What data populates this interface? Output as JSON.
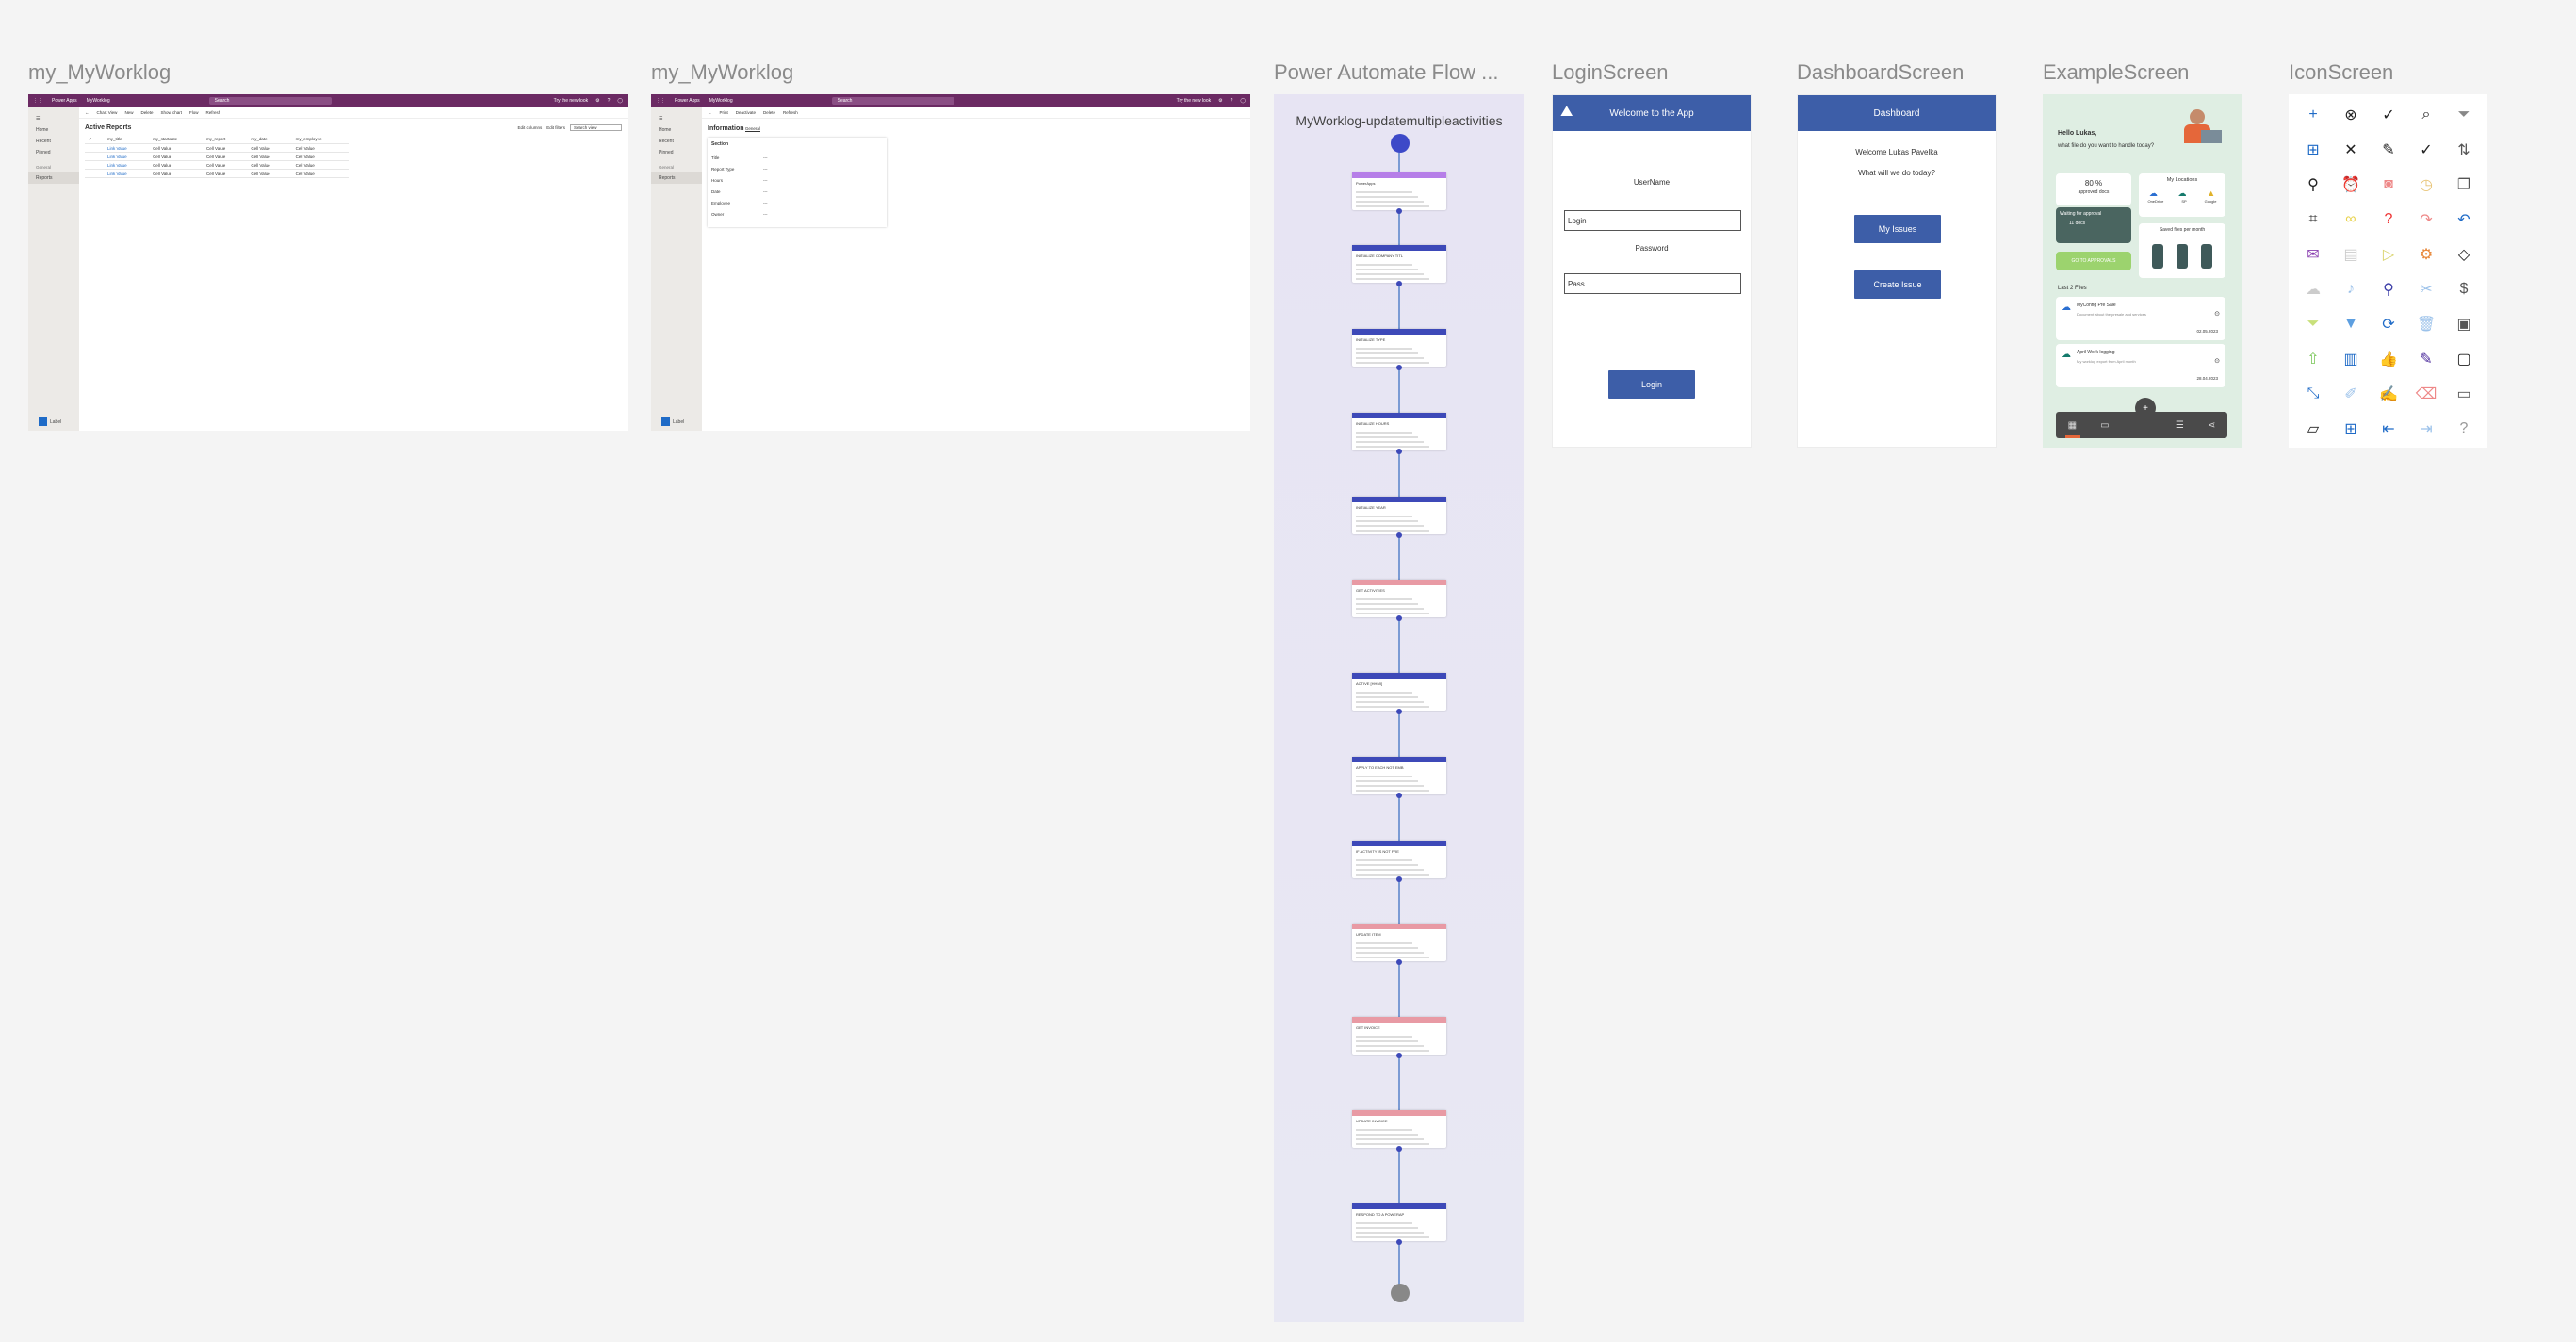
{
  "frames": {
    "f1": {
      "title": "my_MyWorklog"
    },
    "f2": {
      "title": "my_MyWorklog"
    },
    "f3": {
      "title": "Power Automate Flow ..."
    },
    "f4": {
      "title": "LoginScreen"
    },
    "f5": {
      "title": "DashboardScreen"
    },
    "f6": {
      "title": "ExampleScreen"
    },
    "f7": {
      "title": "IconScreen"
    }
  },
  "mda": {
    "app_name": "Power Apps",
    "app_title": "MyWorklog",
    "search": "Search",
    "preview": "Try the new look",
    "nav": {
      "home": "Home",
      "recent": "Recent",
      "pinned": "Pinned",
      "section": "General",
      "reports": "Reports",
      "area": "Label"
    },
    "list": {
      "commands": [
        "Chart View",
        "New",
        "Delete",
        "Show chart",
        "Flow",
        "Refresh"
      ],
      "view_title": "Active Reports",
      "edit_columns": "Edit columns",
      "edit_filters": "Edit filters",
      "filter_placeholder": "Search view",
      "columns": [
        "my_title",
        "my_startdate",
        "my_report",
        "my_date",
        "my_employee"
      ],
      "rows": [
        [
          "Link Value",
          "Cell Value",
          "Cell Value",
          "Cell Value",
          "Cell Value"
        ],
        [
          "Link Value",
          "Cell Value",
          "Cell Value",
          "Cell Value",
          "Cell Value"
        ],
        [
          "Link Value",
          "Cell Value",
          "Cell Value",
          "Cell Value",
          "Cell Value"
        ],
        [
          "Link Value",
          "Cell Value",
          "Cell Value",
          "Cell Value",
          "Cell Value"
        ]
      ]
    },
    "form": {
      "commands": [
        "Print",
        "Deactivate",
        "Delete",
        "Refresh"
      ],
      "title": "Information",
      "tab": "General",
      "section": "Section",
      "fields": [
        "Title",
        "Report Type",
        "Hours",
        "Date",
        "Employee",
        "Owner"
      ],
      "value": "---"
    }
  },
  "flow": {
    "title": "MyWorklog-updatemultipleactivities",
    "nodes": [
      {
        "label": "PowerApps",
        "color": "#b67ee8"
      },
      {
        "label": "INITIALIZE COMPANY TITL",
        "color": "#3d49b8"
      },
      {
        "label": "INITIALIZE TYPE",
        "color": "#3d49b8"
      },
      {
        "label": "INITIALIZE HOURS",
        "color": "#3d49b8"
      },
      {
        "label": "INITIALIZE YEAR",
        "color": "#3d49b8"
      },
      {
        "label": "GET ACTIVITIES",
        "color": "#e89aa4"
      },
      {
        "label": "ACTIVE [HHMI]",
        "color": "#3d49b8"
      },
      {
        "label": "APPLY TO EACH NOT EMB",
        "color": "#3d49b8"
      },
      {
        "label": "IF ACTIVITY IS NOT FRE",
        "color": "#3d49b8"
      },
      {
        "label": "UPDATE ITEM",
        "color": "#e89aa4"
      },
      {
        "label": "GET INVOICE",
        "color": "#e89aa4"
      },
      {
        "label": "UPDATE INVOICE",
        "color": "#e89aa4"
      },
      {
        "label": "RESPOND TO A POWERAP",
        "color": "#3d49b8"
      }
    ]
  },
  "login": {
    "header": "Welcome to the App",
    "username_label": "UserName",
    "username_value": "Login",
    "password_label": "Password",
    "password_value": "Pass",
    "button": "Login"
  },
  "dashboard": {
    "header": "Dashboard",
    "welcome": "Welcome Lukas Pavelka",
    "question": "What will we do today?",
    "btn_issues": "My Issues",
    "btn_create": "Create Issue"
  },
  "example": {
    "greeting": "Hello Lukas,",
    "question": "what file do you want to handle today?",
    "percent": "80 %",
    "percent_sub": "approved docs",
    "locations": "My Locations",
    "loc_names": [
      "OneDrive",
      "SP",
      "Google"
    ],
    "waiting": "Waiting for approval",
    "waiting_count": "11 docs",
    "goto": "GO TO APPROVALS",
    "saved": "Saved files per month",
    "last_files": "Last 2 Files",
    "files": [
      {
        "name": "MyConfig Pre Sale",
        "desc": "Document about the presale and services",
        "date": "02.05.2023"
      },
      {
        "name": "April Work logging",
        "desc": "My worklog export from April month",
        "date": "28.04.2023"
      }
    ]
  },
  "icons": [
    "add-icon",
    "cancel-circle-icon",
    "check-circle-icon",
    "search-icon",
    "filter-icon",
    "document-add-icon",
    "close-icon",
    "edit-icon",
    "check-icon",
    "sort-icon",
    "add-user-icon",
    "alarm-icon",
    "camera-icon",
    "clock-icon",
    "copy-icon",
    "crop-icon",
    "link-icon",
    "help-circle-icon",
    "redo-icon",
    "undo-icon",
    "mail-icon",
    "calendar-icon",
    "send-icon",
    "settings-icon",
    "tag-icon",
    "cloud-icon",
    "microphone-icon",
    "pin-icon",
    "cut-icon",
    "dollar-icon",
    "filter-outline-icon",
    "filter-solid-icon",
    "reload-icon",
    "trash-icon",
    "save-icon",
    "document-up-icon",
    "briefcase-icon",
    "like-icon",
    "pencil-icon",
    "bounding-box-icon",
    "collapse-icon",
    "highlighter-icon",
    "write-icon",
    "eraser-icon",
    "comment-icon",
    "note-icon",
    "add-box-icon",
    "back-arrow-icon",
    "forward-arrow-icon",
    "question-icon"
  ]
}
